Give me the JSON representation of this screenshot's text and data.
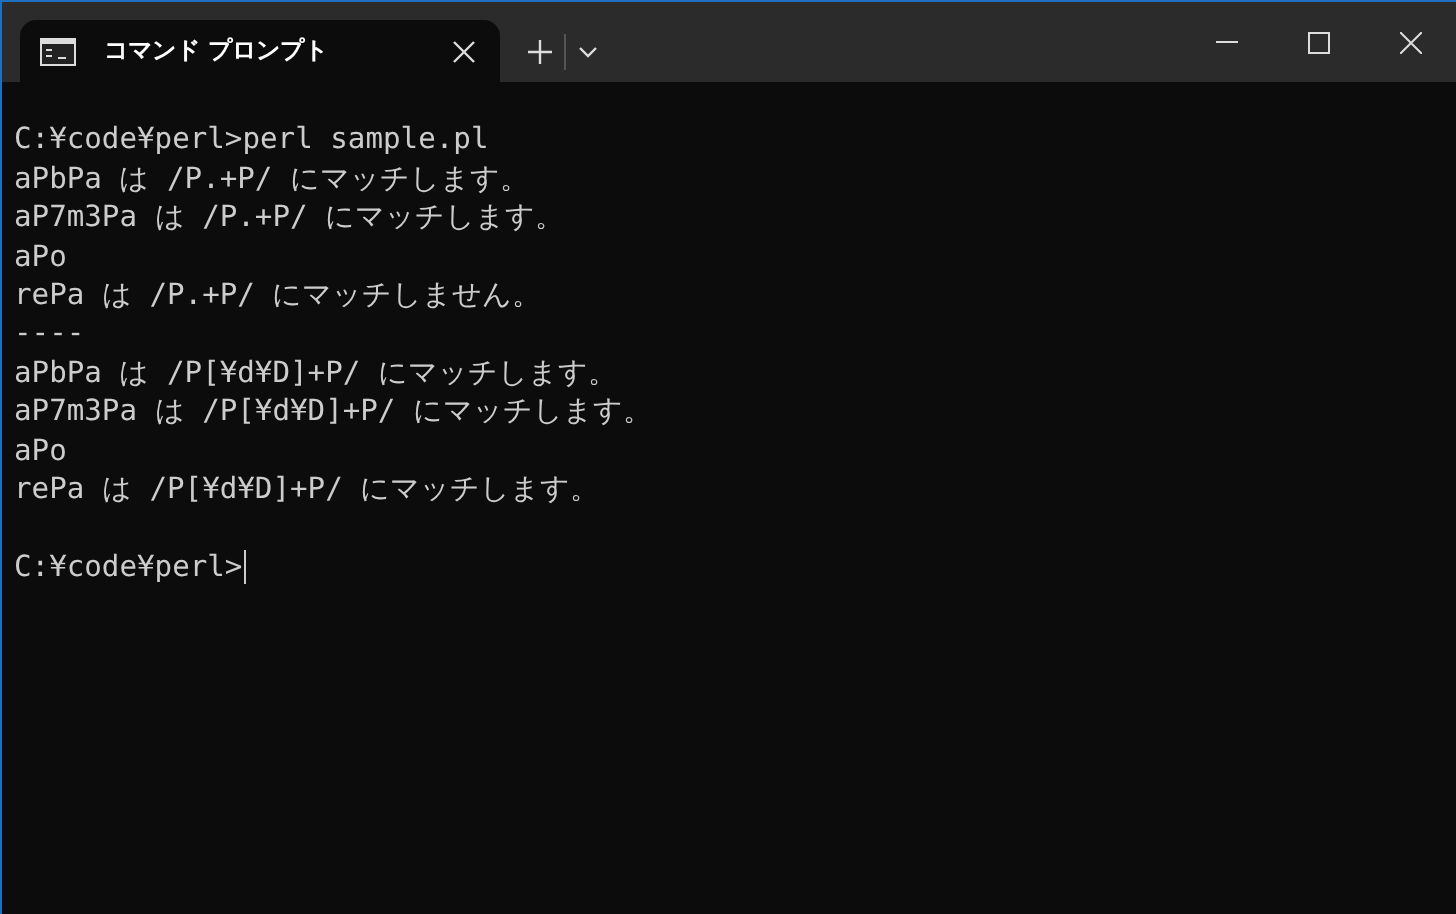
{
  "window": {
    "tabs": [
      {
        "title": "コマンド プロンプト",
        "selected": true
      }
    ]
  },
  "terminal": {
    "lines": [
      {
        "kind": "blank"
      },
      {
        "kind": "text",
        "text": "C:¥code¥perl>perl sample.pl"
      },
      {
        "kind": "text",
        "text": "aPbPa は /P.+P/ にマッチします。"
      },
      {
        "kind": "text",
        "text": "aP7m3Pa は /P.+P/ にマッチします。"
      },
      {
        "kind": "text",
        "text": "aPo"
      },
      {
        "kind": "text",
        "text": "rePa は /P.+P/ にマッチしません。"
      },
      {
        "kind": "text",
        "text": "----"
      },
      {
        "kind": "text",
        "text": "aPbPa は /P[¥d¥D]+P/ にマッチします。"
      },
      {
        "kind": "text",
        "text": "aP7m3Pa は /P[¥d¥D]+P/ にマッチします。"
      },
      {
        "kind": "text",
        "text": "aPo"
      },
      {
        "kind": "text",
        "text": "rePa は /P[¥d¥D]+P/ にマッチします。"
      },
      {
        "kind": "blank"
      },
      {
        "kind": "prompt",
        "text": "C:¥code¥perl>"
      }
    ]
  }
}
